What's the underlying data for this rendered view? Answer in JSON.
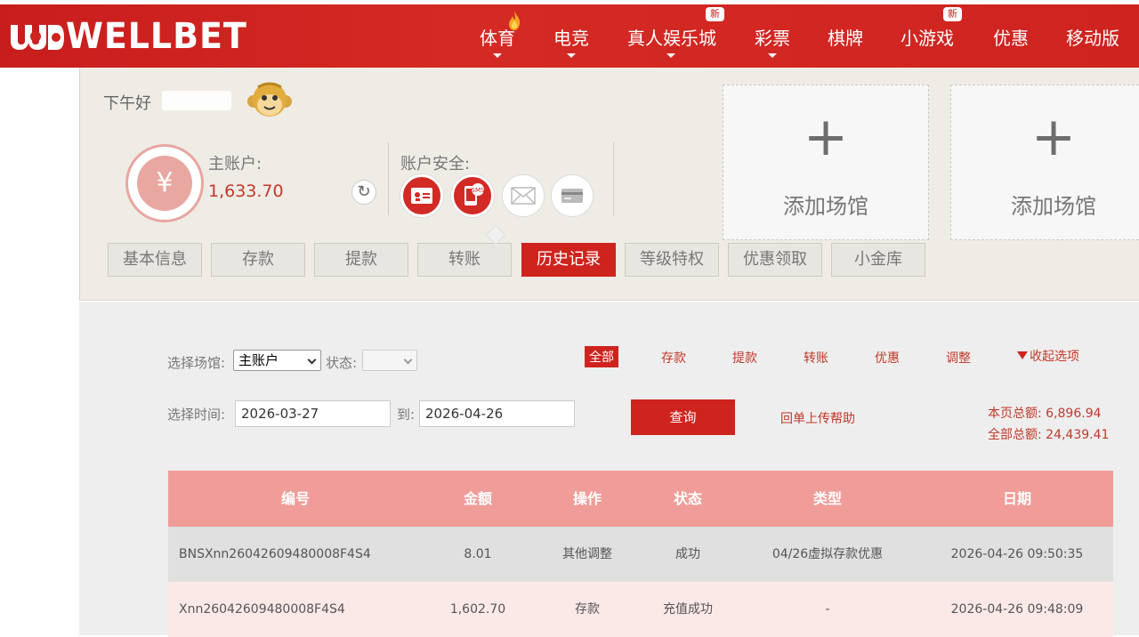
{
  "header": {
    "logo_text": "WELLBET",
    "nav": [
      {
        "label": "体育",
        "has_caret": true,
        "badge": ""
      },
      {
        "label": "电竞",
        "has_caret": true,
        "badge": ""
      },
      {
        "label": "真人娱乐城",
        "has_caret": true,
        "badge": "新"
      },
      {
        "label": "彩票",
        "has_caret": true,
        "badge": ""
      },
      {
        "label": "棋牌",
        "has_caret": false,
        "badge": ""
      },
      {
        "label": "小游戏",
        "has_caret": false,
        "badge": "新"
      },
      {
        "label": "优惠",
        "has_caret": false,
        "badge": ""
      },
      {
        "label": "移动版",
        "has_caret": false,
        "badge": ""
      }
    ]
  },
  "account": {
    "greeting": "下午好",
    "main_account_label": "主账户:",
    "main_account_value": "1,633.70",
    "security_label": "账户安全:",
    "currency_symbol": "¥",
    "sms_text": "SMS"
  },
  "venues": [
    {
      "plus": "+",
      "label": "添加场馆"
    },
    {
      "plus": "+",
      "label": "添加场馆"
    }
  ],
  "tabs": [
    "基本信息",
    "存款",
    "提款",
    "转账",
    "历史记录",
    "等级特权",
    "优惠领取",
    "小金库"
  ],
  "active_tab": "历史记录",
  "filters": {
    "venue_label": "选择场馆:",
    "venue_value": "主账户",
    "status_label": "状态:",
    "status_value": "",
    "time_label": "选择时间:",
    "date_from": "2026-03-27",
    "to_label": "到:",
    "date_to": "2026-04-26",
    "query_button": "查询",
    "help_link": "回单上传帮助",
    "types": [
      "全部",
      "存款",
      "提款",
      "转账",
      "优惠",
      "调整"
    ],
    "active_type": "全部",
    "collapse_label": "收起选项"
  },
  "totals": {
    "page_total": "本页总额: 6,896.94",
    "all_total": "全部总额: 24,439.41"
  },
  "table": {
    "columns": [
      "编号",
      "金额",
      "操作",
      "状态",
      "类型",
      "日期"
    ],
    "rows": [
      [
        "BNSXnn26042609480008F4S4",
        "8.01",
        "其他调整",
        "成功",
        "04/26虚拟存款优惠",
        "2026-04-26 09:50:35"
      ],
      [
        "Xnn26042609480008F4S4",
        "1,602.70",
        "存款",
        "充值成功",
        "-",
        "2026-04-26 09:48:09"
      ]
    ]
  },
  "colors": {
    "brand_red": "#cf231e",
    "header_pink": "#f09d99"
  }
}
